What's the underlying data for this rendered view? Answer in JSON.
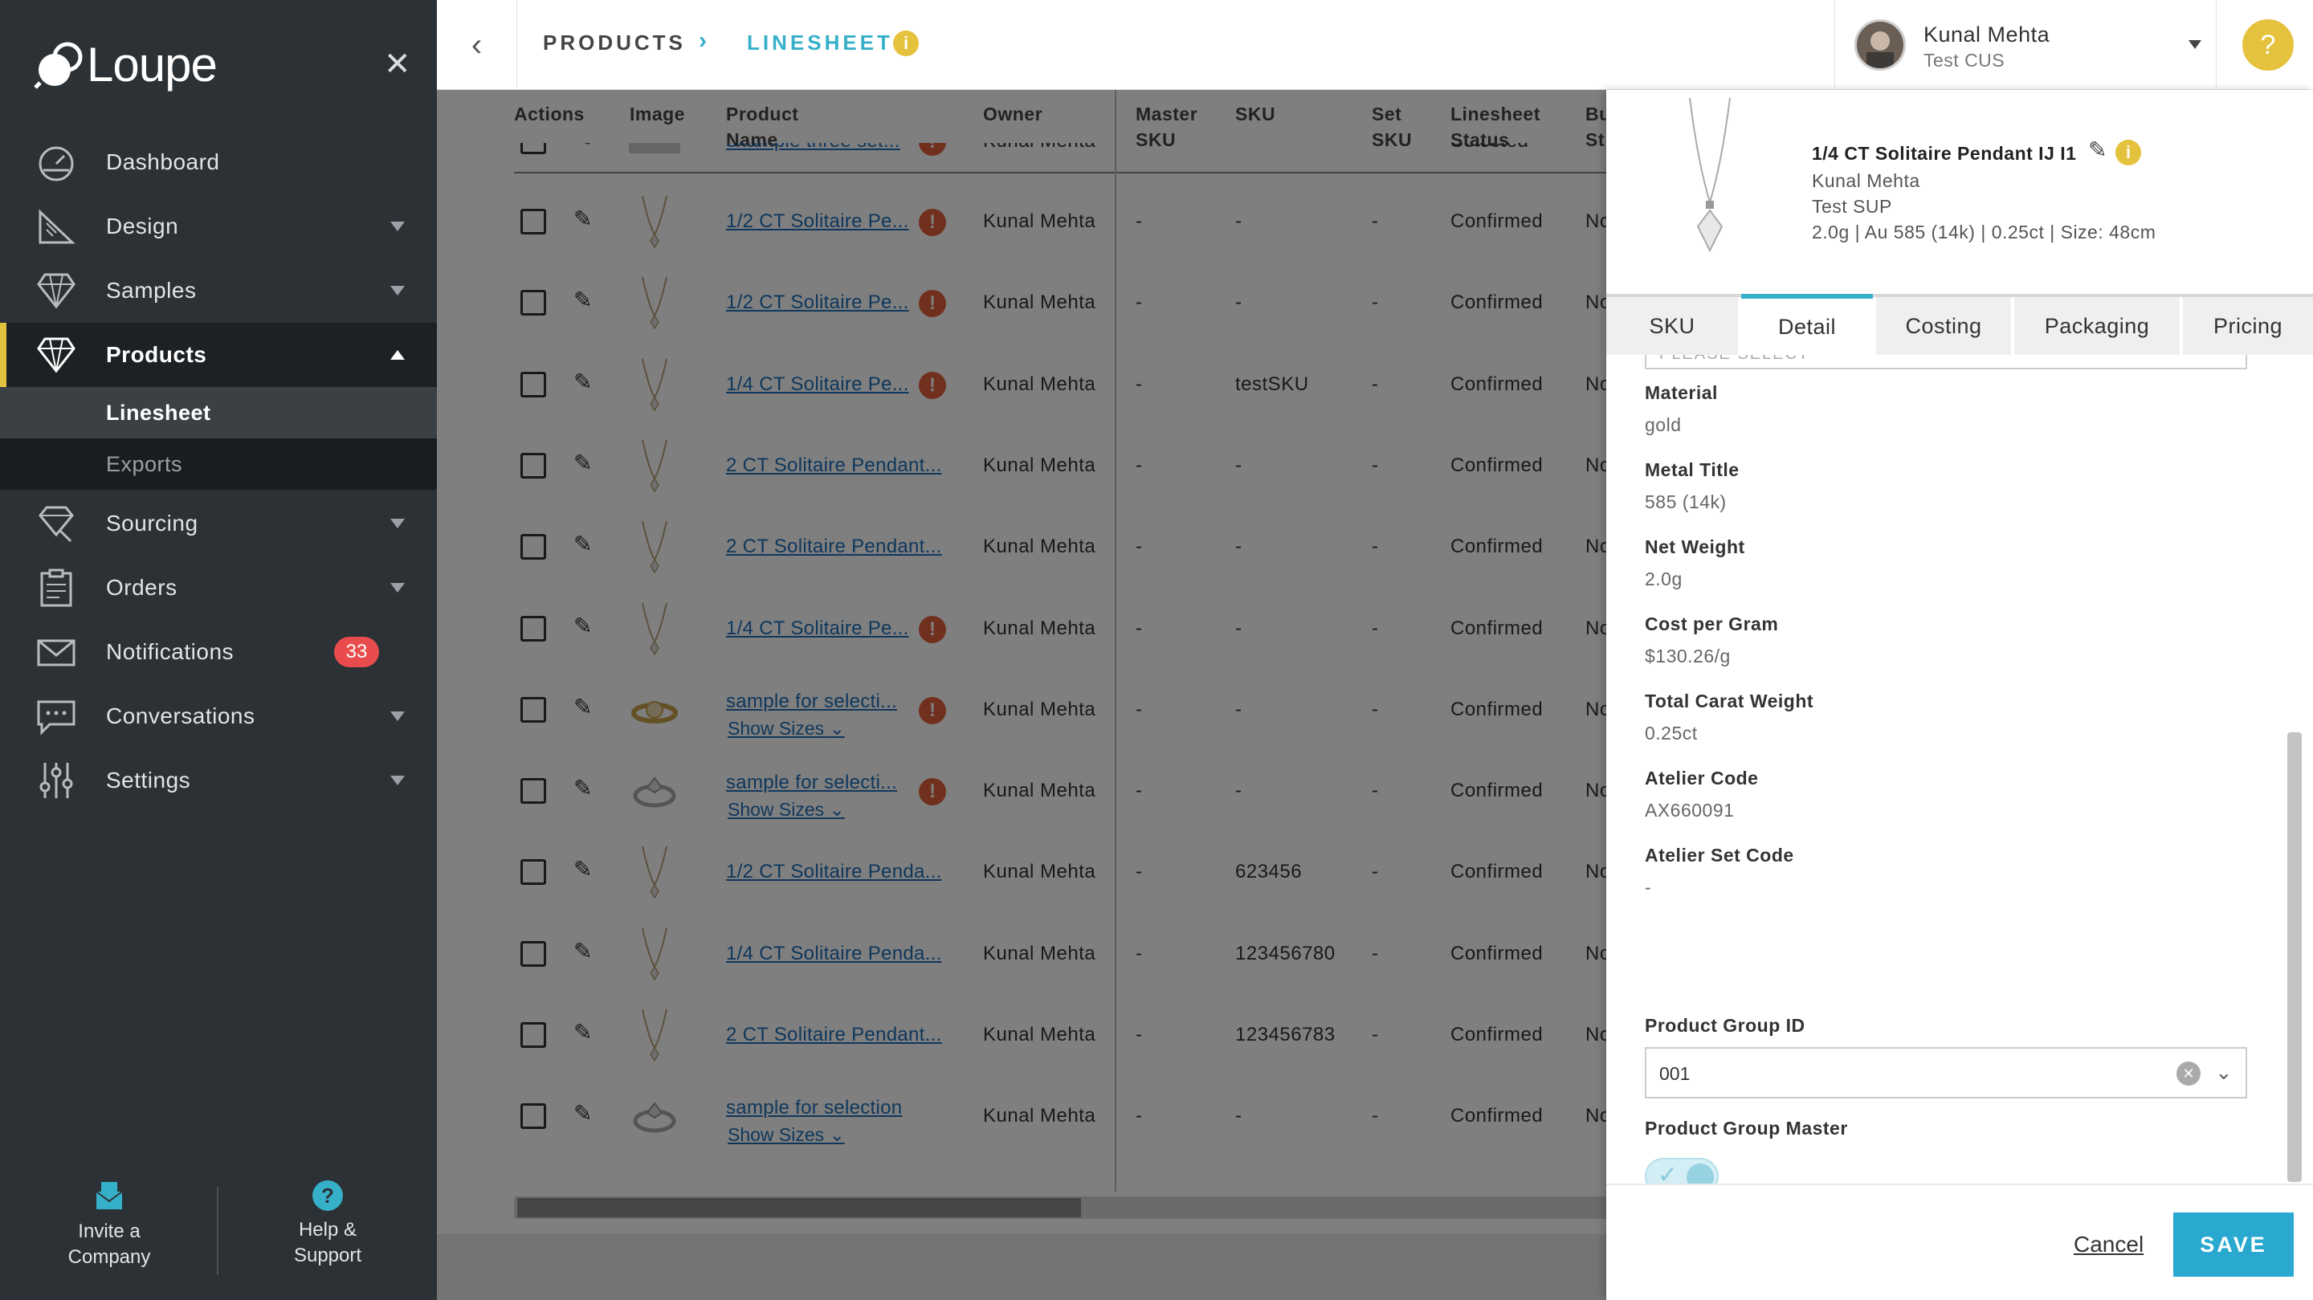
{
  "app": {
    "name": "Loupe"
  },
  "sidebar": {
    "items": [
      {
        "label": "Dashboard",
        "icon": "dashboard-gauge-icon",
        "has_caret": false
      },
      {
        "label": "Design",
        "icon": "design-ruler-icon",
        "has_caret": true
      },
      {
        "label": "Samples",
        "icon": "samples-diamond-icon",
        "has_caret": true
      },
      {
        "label": "Products",
        "icon": "products-diamond-icon",
        "has_caret": true,
        "active": true
      },
      {
        "label": "Sourcing",
        "icon": "sourcing-diamond-icon",
        "has_caret": true
      },
      {
        "label": "Orders",
        "icon": "orders-clipboard-icon",
        "has_caret": true
      },
      {
        "label": "Notifications",
        "icon": "notifications-envelope-icon",
        "badge": "33"
      },
      {
        "label": "Conversations",
        "icon": "conversations-chat-icon",
        "has_caret": true
      },
      {
        "label": "Settings",
        "icon": "settings-sliders-icon",
        "has_caret": true
      }
    ],
    "sub_items": [
      {
        "label": "Linesheet",
        "selected": true
      },
      {
        "label": "Exports",
        "selected": false
      }
    ],
    "bottom": {
      "invite_line1": "Invite a",
      "invite_line2": "Company",
      "help_line1": "Help &",
      "help_line2": "Support"
    }
  },
  "topbar": {
    "breadcrumb_1": "PRODUCTS",
    "breadcrumb_sep": "›",
    "breadcrumb_2": "LINESHEET",
    "info": "i",
    "user_name": "Kunal Mehta",
    "user_org": "Test CUS",
    "help": "?"
  },
  "table": {
    "headers": {
      "actions": "Actions",
      "image": "Image",
      "product_name_1": "Product",
      "product_name_2": "Name",
      "owner": "Owner",
      "master_sku_1": "Master",
      "master_sku_2": "SKU",
      "sku": "SKU",
      "set_sku_1": "Set",
      "set_sku_2": "SKU",
      "status_1": "Linesheet",
      "status_2": "Status",
      "bu_1": "Bu",
      "bu_2": "St"
    },
    "show_sizes": "Show Sizes",
    "rows": [
      {
        "name": "example three set...",
        "owner": "Kunal Mehta",
        "master_sku": "-",
        "sku": "-",
        "set_sku": "-",
        "status": "Selected",
        "bu": "-",
        "warn": true,
        "thumb": "set"
      },
      {
        "name": "1/2 CT Solitaire Pe...",
        "owner": "Kunal Mehta",
        "master_sku": "-",
        "sku": "-",
        "set_sku": "-",
        "status": "Confirmed",
        "bu": "No",
        "warn": true,
        "thumb": "pendant"
      },
      {
        "name": "1/2 CT Solitaire Pe...",
        "owner": "Kunal Mehta",
        "master_sku": "-",
        "sku": "-",
        "set_sku": "-",
        "status": "Confirmed",
        "bu": "No",
        "warn": true,
        "thumb": "pendant"
      },
      {
        "name": "1/4 CT Solitaire Pe...",
        "owner": "Kunal Mehta",
        "master_sku": "-",
        "sku": "testSKU",
        "set_sku": "-",
        "status": "Confirmed",
        "bu": "No",
        "warn": true,
        "thumb": "pendant"
      },
      {
        "name": "2 CT Solitaire Pendant...",
        "owner": "Kunal Mehta",
        "master_sku": "-",
        "sku": "-",
        "set_sku": "-",
        "status": "Confirmed",
        "bu": "No",
        "warn": false,
        "thumb": "pendant"
      },
      {
        "name": "2 CT Solitaire Pendant...",
        "owner": "Kunal Mehta",
        "master_sku": "-",
        "sku": "-",
        "set_sku": "-",
        "status": "Confirmed",
        "bu": "No",
        "warn": false,
        "thumb": "pendant"
      },
      {
        "name": "1/4 CT Solitaire Pe...",
        "owner": "Kunal Mehta",
        "master_sku": "-",
        "sku": "-",
        "set_sku": "-",
        "status": "Confirmed",
        "bu": "No",
        "warn": true,
        "thumb": "pendant"
      },
      {
        "name": "sample for selecti...",
        "owner": "Kunal Mehta",
        "master_sku": "-",
        "sku": "-",
        "set_sku": "-",
        "status": "Confirmed",
        "bu": "No",
        "warn": true,
        "thumb": "ring-gold",
        "sizes": true
      },
      {
        "name": "sample for selecti...",
        "owner": "Kunal Mehta",
        "master_sku": "-",
        "sku": "-",
        "set_sku": "-",
        "status": "Confirmed",
        "bu": "No",
        "warn": true,
        "thumb": "ring",
        "sizes": true
      },
      {
        "name": "1/2 CT Solitaire Penda...",
        "owner": "Kunal Mehta",
        "master_sku": "-",
        "sku": "623456",
        "set_sku": "-",
        "status": "Confirmed",
        "bu": "No",
        "warn": false,
        "thumb": "pendant"
      },
      {
        "name": "1/4 CT Solitaire Penda...",
        "owner": "Kunal Mehta",
        "master_sku": "-",
        "sku": "123456780",
        "set_sku": "-",
        "status": "Confirmed",
        "bu": "No",
        "warn": false,
        "thumb": "pendant"
      },
      {
        "name": "2 CT Solitaire Pendant...",
        "owner": "Kunal Mehta",
        "master_sku": "-",
        "sku": "123456783",
        "set_sku": "-",
        "status": "Confirmed",
        "bu": "No",
        "warn": false,
        "thumb": "pendant"
      },
      {
        "name": "sample for selection",
        "owner": "Kunal Mehta",
        "master_sku": "-",
        "sku": "-",
        "set_sku": "-",
        "status": "Confirmed",
        "bu": "No",
        "warn": false,
        "thumb": "ring",
        "sizes": true
      }
    ]
  },
  "panel": {
    "title": "1/4 CT Solitaire Pendant IJ I1",
    "owner": "Kunal Mehta",
    "supplier": "Test SUP",
    "summary": "2.0g | Au 585 (14k) | 0.25ct | Size: 48cm",
    "tabs": [
      "SKU",
      "Detail",
      "Costing",
      "Packaging",
      "Pricing"
    ],
    "active_tab": "Detail",
    "partial_select": "PLEASE SELECT",
    "fields": [
      {
        "label": "Material",
        "value": "gold"
      },
      {
        "label": "Metal Title",
        "value": "585 (14k)"
      },
      {
        "label": "Net Weight",
        "value": "2.0g"
      },
      {
        "label": "Cost per Gram",
        "value": "$130.26/g"
      },
      {
        "label": "Total Carat Weight",
        "value": "0.25ct"
      },
      {
        "label": "Atelier Code",
        "value": "AX660091"
      },
      {
        "label": "Atelier Set Code",
        "value": "-"
      }
    ],
    "product_group_id_label": "Product Group ID",
    "product_group_id_value": "001",
    "product_group_master_label": "Product Group Master",
    "product_group_master_on": true,
    "cancel": "Cancel",
    "save": "SAVE"
  },
  "colors": {
    "accent": "#36b0c9",
    "brand_yellow": "#e5c23d",
    "save": "#29a9d0",
    "warning": "#e2603a",
    "badge": "#e84c4c",
    "sidebar_bg": "#2c3135"
  }
}
